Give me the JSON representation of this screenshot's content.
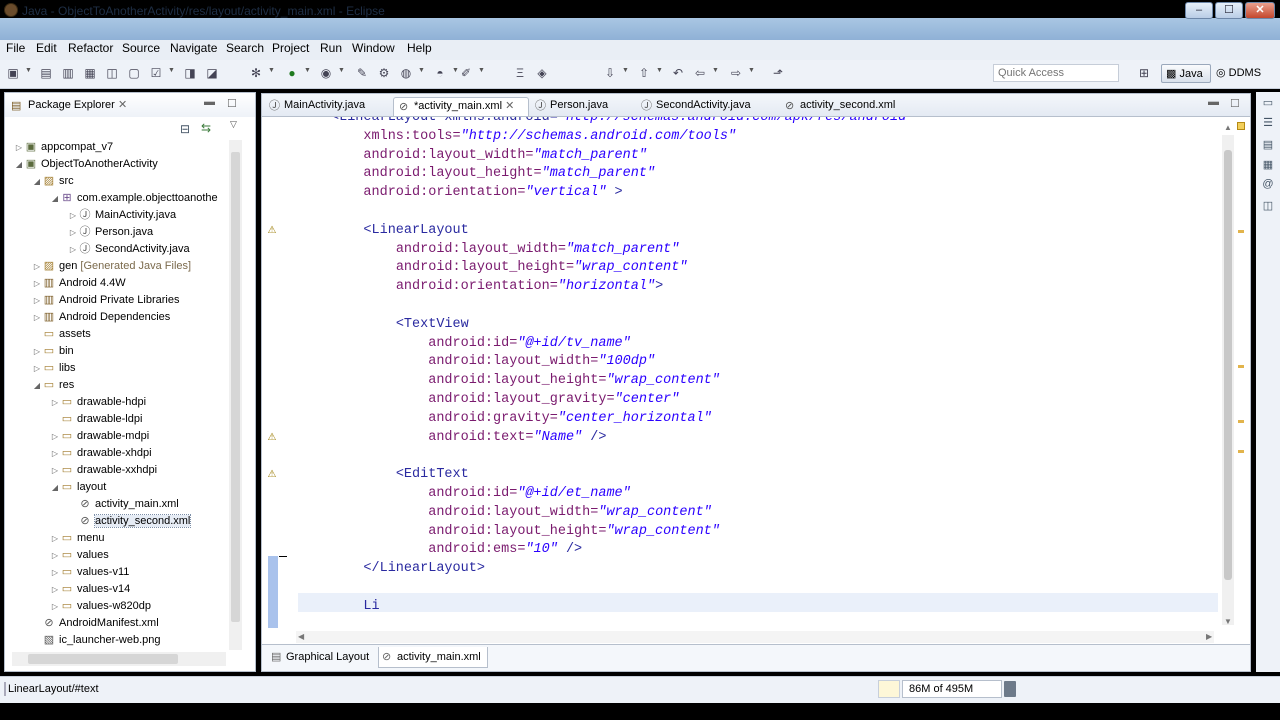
{
  "window": {
    "title": "Java - ObjectToAnotherActivity/res/layout/activity_main.xml - Eclipse",
    "min": "–",
    "max": "☐",
    "close": "✕"
  },
  "menu": [
    "File",
    "Edit",
    "Refactor",
    "Source",
    "Navigate",
    "Search",
    "Project",
    "Run",
    "Window",
    "Help"
  ],
  "toolbar": {
    "quick_access_placeholder": "Quick Access",
    "perspectives": {
      "java": "Java",
      "ddms": "DDMS"
    }
  },
  "package_explorer": {
    "title": "Package Explorer",
    "tree": [
      {
        "label": "appcompat_v7",
        "depth": 1,
        "twisty": "▷",
        "icon": "project-icon"
      },
      {
        "label": "ObjectToAnotherActivity",
        "depth": 1,
        "twisty": "◢",
        "icon": "project-icon"
      },
      {
        "label": "src",
        "depth": 2,
        "twisty": "◢",
        "icon": "source-folder-icon"
      },
      {
        "label": "com.example.objecttoanothe",
        "depth": 3,
        "twisty": "◢",
        "icon": "package-icon"
      },
      {
        "label": "MainActivity.java",
        "depth": 4,
        "twisty": "▷",
        "icon": "java-file-icon"
      },
      {
        "label": "Person.java",
        "depth": 4,
        "twisty": "▷",
        "icon": "java-file-icon"
      },
      {
        "label": "SecondActivity.java",
        "depth": 4,
        "twisty": "▷",
        "icon": "java-file-icon"
      },
      {
        "label": "gen",
        "decoration": "[Generated Java Files]",
        "depth": 2,
        "twisty": "▷",
        "icon": "source-folder-icon"
      },
      {
        "label": "Android 4.4W",
        "depth": 2,
        "twisty": "▷",
        "icon": "library-icon"
      },
      {
        "label": "Android Private Libraries",
        "depth": 2,
        "twisty": "▷",
        "icon": "library-icon"
      },
      {
        "label": "Android Dependencies",
        "depth": 2,
        "twisty": "▷",
        "icon": "library-icon"
      },
      {
        "label": "assets",
        "depth": 2,
        "twisty": "",
        "icon": "folder-icon"
      },
      {
        "label": "bin",
        "depth": 2,
        "twisty": "▷",
        "icon": "folder-icon"
      },
      {
        "label": "libs",
        "depth": 2,
        "twisty": "▷",
        "icon": "folder-icon"
      },
      {
        "label": "res",
        "depth": 2,
        "twisty": "◢",
        "icon": "folder-icon"
      },
      {
        "label": "drawable-hdpi",
        "depth": 3,
        "twisty": "▷",
        "icon": "folder-icon"
      },
      {
        "label": "drawable-ldpi",
        "depth": 3,
        "twisty": "",
        "icon": "folder-icon"
      },
      {
        "label": "drawable-mdpi",
        "depth": 3,
        "twisty": "▷",
        "icon": "folder-icon"
      },
      {
        "label": "drawable-xhdpi",
        "depth": 3,
        "twisty": "▷",
        "icon": "folder-icon"
      },
      {
        "label": "drawable-xxhdpi",
        "depth": 3,
        "twisty": "▷",
        "icon": "folder-icon"
      },
      {
        "label": "layout",
        "depth": 3,
        "twisty": "◢",
        "icon": "folder-icon"
      },
      {
        "label": "activity_main.xml",
        "depth": 4,
        "twisty": "",
        "icon": "xml-file-icon"
      },
      {
        "label": "activity_second.xml",
        "depth": 4,
        "twisty": "",
        "icon": "xml-file-icon",
        "selected": true
      },
      {
        "label": "menu",
        "depth": 3,
        "twisty": "▷",
        "icon": "folder-icon"
      },
      {
        "label": "values",
        "depth": 3,
        "twisty": "▷",
        "icon": "folder-icon"
      },
      {
        "label": "values-v11",
        "depth": 3,
        "twisty": "▷",
        "icon": "folder-icon"
      },
      {
        "label": "values-v14",
        "depth": 3,
        "twisty": "▷",
        "icon": "folder-icon"
      },
      {
        "label": "values-w820dp",
        "depth": 3,
        "twisty": "▷",
        "icon": "folder-icon"
      },
      {
        "label": "AndroidManifest.xml",
        "depth": 2,
        "twisty": "",
        "icon": "xml-file-icon"
      },
      {
        "label": "ic_launcher-web.png",
        "depth": 2,
        "twisty": "",
        "icon": "image-file-icon"
      }
    ]
  },
  "editor": {
    "tabs": [
      {
        "label": "MainActivity.java",
        "active": false,
        "icon": "java-file-icon"
      },
      {
        "label": "*activity_main.xml",
        "active": true,
        "icon": "xml-file-icon"
      },
      {
        "label": "Person.java",
        "active": false,
        "icon": "java-file-icon"
      },
      {
        "label": "SecondActivity.java",
        "active": false,
        "icon": "java-file-icon"
      },
      {
        "label": "activity_second.xml",
        "active": false,
        "icon": "xml-file-icon"
      }
    ],
    "lines": [
      {
        "indent": "",
        "parts": [
          [
            "t",
            "<LinearLayout xmlns:android="
          ],
          [
            "v",
            "\"http://schemas.android.com/apk/res/android\""
          ]
        ],
        "partial": true
      },
      {
        "indent": "    ",
        "parts": [
          [
            "a",
            "xmlns:tools="
          ],
          [
            "v",
            "\"http://schemas.android.com/tools\""
          ]
        ]
      },
      {
        "indent": "    ",
        "parts": [
          [
            "a",
            "android:layout_width="
          ],
          [
            "v",
            "\"match_parent\""
          ]
        ]
      },
      {
        "indent": "    ",
        "parts": [
          [
            "a",
            "android:layout_height="
          ],
          [
            "v",
            "\"match_parent\""
          ]
        ]
      },
      {
        "indent": "    ",
        "parts": [
          [
            "a",
            "android:orientation="
          ],
          [
            "v",
            "\"vertical\""
          ],
          [
            "t",
            " >"
          ]
        ]
      },
      {
        "indent": "",
        "parts": []
      },
      {
        "indent": "    ",
        "parts": [
          [
            "t",
            "<LinearLayout"
          ]
        ],
        "warn": true
      },
      {
        "indent": "        ",
        "parts": [
          [
            "a",
            "android:layout_width="
          ],
          [
            "v",
            "\"match_parent\""
          ]
        ]
      },
      {
        "indent": "        ",
        "parts": [
          [
            "a",
            "android:layout_height="
          ],
          [
            "v",
            "\"wrap_content\""
          ]
        ]
      },
      {
        "indent": "        ",
        "parts": [
          [
            "a",
            "android:orientation="
          ],
          [
            "v",
            "\"horizontal\""
          ],
          [
            "t",
            ">"
          ]
        ]
      },
      {
        "indent": "",
        "parts": []
      },
      {
        "indent": "        ",
        "parts": [
          [
            "t",
            "<TextView"
          ]
        ]
      },
      {
        "indent": "            ",
        "parts": [
          [
            "a",
            "android:id="
          ],
          [
            "v",
            "\"@+id/tv_name\""
          ]
        ]
      },
      {
        "indent": "            ",
        "parts": [
          [
            "a",
            "android:layout_width="
          ],
          [
            "v",
            "\"100dp\""
          ]
        ]
      },
      {
        "indent": "            ",
        "parts": [
          [
            "a",
            "android:layout_height="
          ],
          [
            "v",
            "\"wrap_content\""
          ]
        ]
      },
      {
        "indent": "            ",
        "parts": [
          [
            "a",
            "android:layout_gravity="
          ],
          [
            "v",
            "\"center\""
          ]
        ]
      },
      {
        "indent": "            ",
        "parts": [
          [
            "a",
            "android:gravity="
          ],
          [
            "v",
            "\"center_horizontal\""
          ]
        ]
      },
      {
        "indent": "            ",
        "parts": [
          [
            "a",
            "android:text="
          ],
          [
            "v",
            "\"Name\""
          ],
          [
            "t",
            " />"
          ]
        ],
        "warn": true
      },
      {
        "indent": "",
        "parts": []
      },
      {
        "indent": "        ",
        "parts": [
          [
            "t",
            "<EditText"
          ]
        ],
        "warn": true
      },
      {
        "indent": "            ",
        "parts": [
          [
            "a",
            "android:id="
          ],
          [
            "v",
            "\"@+id/et_name\""
          ]
        ]
      },
      {
        "indent": "            ",
        "parts": [
          [
            "a",
            "android:layout_width="
          ],
          [
            "v",
            "\"wrap_content\""
          ]
        ]
      },
      {
        "indent": "            ",
        "parts": [
          [
            "a",
            "android:layout_height="
          ],
          [
            "v",
            "\"wrap_content\""
          ]
        ]
      },
      {
        "indent": "            ",
        "parts": [
          [
            "a",
            "android:ems="
          ],
          [
            "v",
            "\"10\""
          ],
          [
            "t",
            " />"
          ]
        ]
      },
      {
        "indent": "    ",
        "parts": [
          [
            "t",
            "</LinearLayout>"
          ]
        ]
      },
      {
        "indent": "",
        "parts": []
      },
      {
        "indent": "    ",
        "parts": [
          [
            "t",
            "Li"
          ]
        ],
        "current": true
      }
    ]
  },
  "bottom_tabs": [
    {
      "label": "Graphical Layout",
      "icon": "layout-icon"
    },
    {
      "label": "activity_main.xml",
      "icon": "xml-file-icon"
    }
  ],
  "status": {
    "text": "LinearLayout/#text",
    "heap": "86M of 495M"
  }
}
